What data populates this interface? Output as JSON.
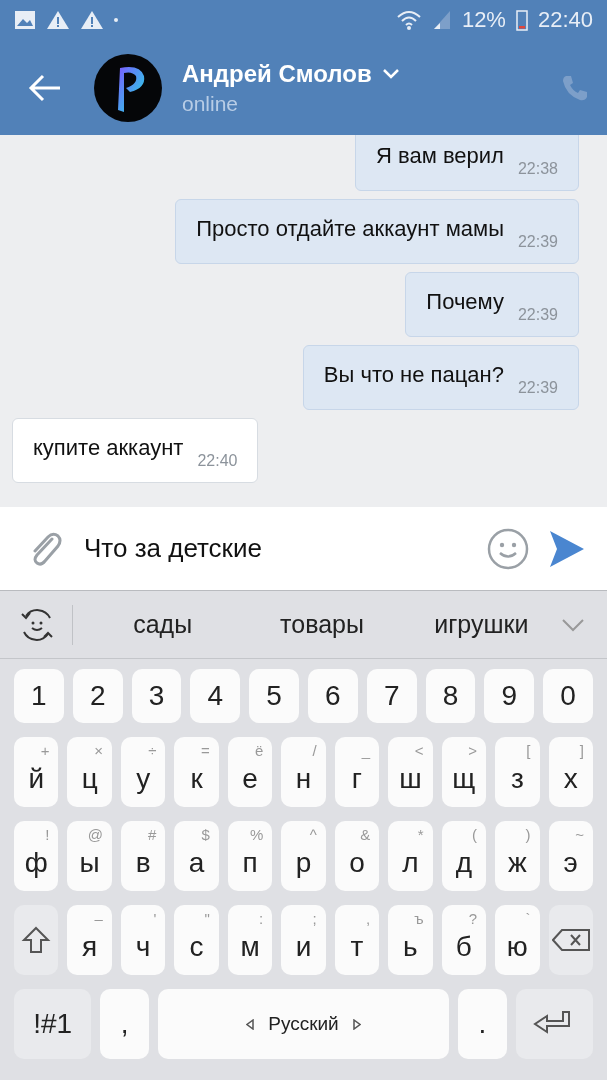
{
  "status_bar": {
    "battery": "12%",
    "time": "22:40"
  },
  "header": {
    "name": "Андрей Смолов",
    "status": "online"
  },
  "messages": [
    {
      "outgoing": true,
      "text": "Я вам верил",
      "time": "22:38"
    },
    {
      "outgoing": true,
      "text": "Просто отдайте аккаунт мамы",
      "time": "22:39"
    },
    {
      "outgoing": true,
      "text": "Почему",
      "time": "22:39"
    },
    {
      "outgoing": true,
      "text": "Вы что не пацан?",
      "time": "22:39"
    },
    {
      "outgoing": false,
      "text": "купите аккаунт",
      "time": "22:40"
    }
  ],
  "composer": {
    "value": "Что за детские"
  },
  "suggestions": [
    "сады",
    "товары",
    "игрушки"
  ],
  "keyboard": {
    "digits": [
      "1",
      "2",
      "3",
      "4",
      "5",
      "6",
      "7",
      "8",
      "9",
      "0"
    ],
    "letter_rows": [
      [
        {
          "kind": "letter",
          "label": "й",
          "hint": "+"
        },
        {
          "kind": "letter",
          "label": "ц",
          "hint": "×"
        },
        {
          "kind": "letter",
          "label": "у",
          "hint": "÷"
        },
        {
          "kind": "letter",
          "label": "к",
          "hint": "="
        },
        {
          "kind": "letter",
          "label": "е",
          "hint": "ё"
        },
        {
          "kind": "letter",
          "label": "н",
          "hint": "/"
        },
        {
          "kind": "letter",
          "label": "г",
          "hint": "_"
        },
        {
          "kind": "letter",
          "label": "ш",
          "hint": "<"
        },
        {
          "kind": "letter",
          "label": "щ",
          "hint": ">"
        },
        {
          "kind": "letter",
          "label": "з",
          "hint": "["
        },
        {
          "kind": "letter",
          "label": "х",
          "hint": "]"
        }
      ],
      [
        {
          "kind": "letter",
          "label": "ф",
          "hint": "!"
        },
        {
          "kind": "letter",
          "label": "ы",
          "hint": "@"
        },
        {
          "kind": "letter",
          "label": "в",
          "hint": "#"
        },
        {
          "kind": "letter",
          "label": "а",
          "hint": "$"
        },
        {
          "kind": "letter",
          "label": "п",
          "hint": "%"
        },
        {
          "kind": "letter",
          "label": "р",
          "hint": "^"
        },
        {
          "kind": "letter",
          "label": "о",
          "hint": "&"
        },
        {
          "kind": "letter",
          "label": "л",
          "hint": "*"
        },
        {
          "kind": "letter",
          "label": "д",
          "hint": "("
        },
        {
          "kind": "letter",
          "label": "ж",
          "hint": ")"
        },
        {
          "kind": "letter",
          "label": "э",
          "hint": "~"
        }
      ],
      [
        {
          "kind": "shift"
        },
        {
          "kind": "letter",
          "label": "я",
          "hint": "–"
        },
        {
          "kind": "letter",
          "label": "ч",
          "hint": "'"
        },
        {
          "kind": "letter",
          "label": "с",
          "hint": "\""
        },
        {
          "kind": "letter",
          "label": "м",
          "hint": ":"
        },
        {
          "kind": "letter",
          "label": "и",
          "hint": ";"
        },
        {
          "kind": "letter",
          "label": "т",
          "hint": ","
        },
        {
          "kind": "letter",
          "label": "ь",
          "hint": "ъ"
        },
        {
          "kind": "letter",
          "label": "б",
          "hint": "?"
        },
        {
          "kind": "letter",
          "label": "ю",
          "hint": "`"
        },
        {
          "kind": "backspace"
        }
      ]
    ],
    "bottom_row": [
      {
        "kind": "symbols",
        "label": "!#1"
      },
      {
        "kind": "punct",
        "label": ","
      },
      {
        "kind": "space",
        "label": "Русский"
      },
      {
        "kind": "punct",
        "label": "."
      },
      {
        "kind": "enter"
      }
    ]
  }
}
